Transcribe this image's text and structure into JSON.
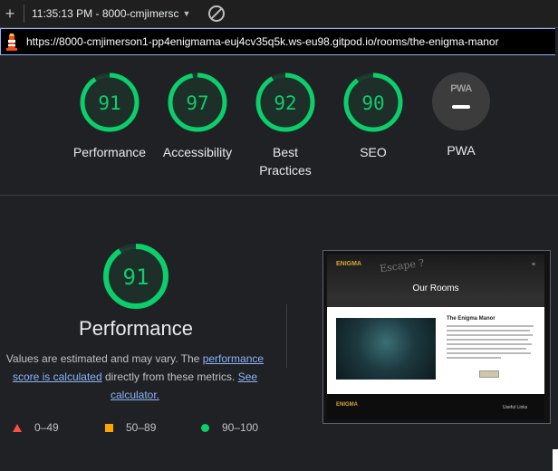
{
  "tab": {
    "title": "11:35:13 PM - 8000-cmjimersc"
  },
  "url": "https://8000-cmjimerson1-pp4enigmama-euj4cv35q5k.ws-eu98.gitpod.io/rooms/the-enigma-manor",
  "colors": {
    "pass": "#0cce6b",
    "average": "#ffa400",
    "fail": "#ff4e42",
    "link": "#8ab4f8"
  },
  "categories": [
    {
      "score": "91",
      "label": "Performance",
      "value": 0.91
    },
    {
      "score": "97",
      "label": "Accessibility",
      "value": 0.97
    },
    {
      "score": "92",
      "label": "Best Practices",
      "value": 0.92
    },
    {
      "score": "90",
      "label": "SEO",
      "value": 0.9
    }
  ],
  "pwa": {
    "badge": "PWA",
    "label": "PWA"
  },
  "performance": {
    "score": "91",
    "value": 0.91,
    "title": "Performance",
    "desc_part1": "Values are estimated and may vary. The ",
    "link1": "performance score is calculated",
    "desc_part2": " directly from these metrics. ",
    "link2": "See calculator."
  },
  "legend": {
    "fail": "0–49",
    "average": "50–89",
    "pass": "90–100"
  },
  "thumbnail": {
    "logo": "ENIGMA",
    "hero_title": "Our Rooms",
    "sign_text": "Escape ?",
    "card_title": "The Enigma Manor",
    "footer_logo": "ENIGMA",
    "footer_links": "Useful Links"
  }
}
